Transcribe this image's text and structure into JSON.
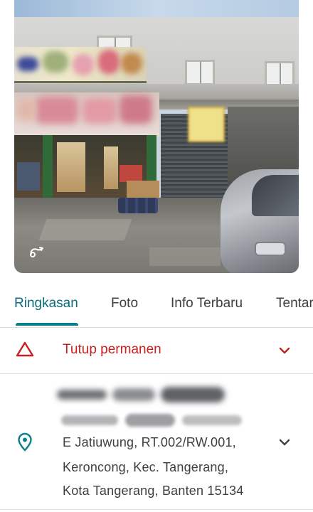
{
  "photo": {
    "icon": "street-view-path-icon"
  },
  "tabs": [
    {
      "label": "Ringkasan",
      "active": true
    },
    {
      "label": "Foto",
      "active": false
    },
    {
      "label": "Info Terbaru",
      "active": false
    },
    {
      "label": "Tentar",
      "active": false
    }
  ],
  "status": {
    "icon": "warning-triangle-icon",
    "label": "Tutup permanen",
    "color": "#c5221f"
  },
  "address": {
    "icon": "location-pin-icon",
    "line1": "E Jatiuwung, RT.002/RW.001,",
    "line2": "Keroncong, Kec. Tangerang,",
    "line3": "Kota Tangerang, Banten 15134"
  },
  "colors": {
    "accent": "#0b7f8a",
    "text": "#3c4043",
    "divider": "#dadce0"
  }
}
